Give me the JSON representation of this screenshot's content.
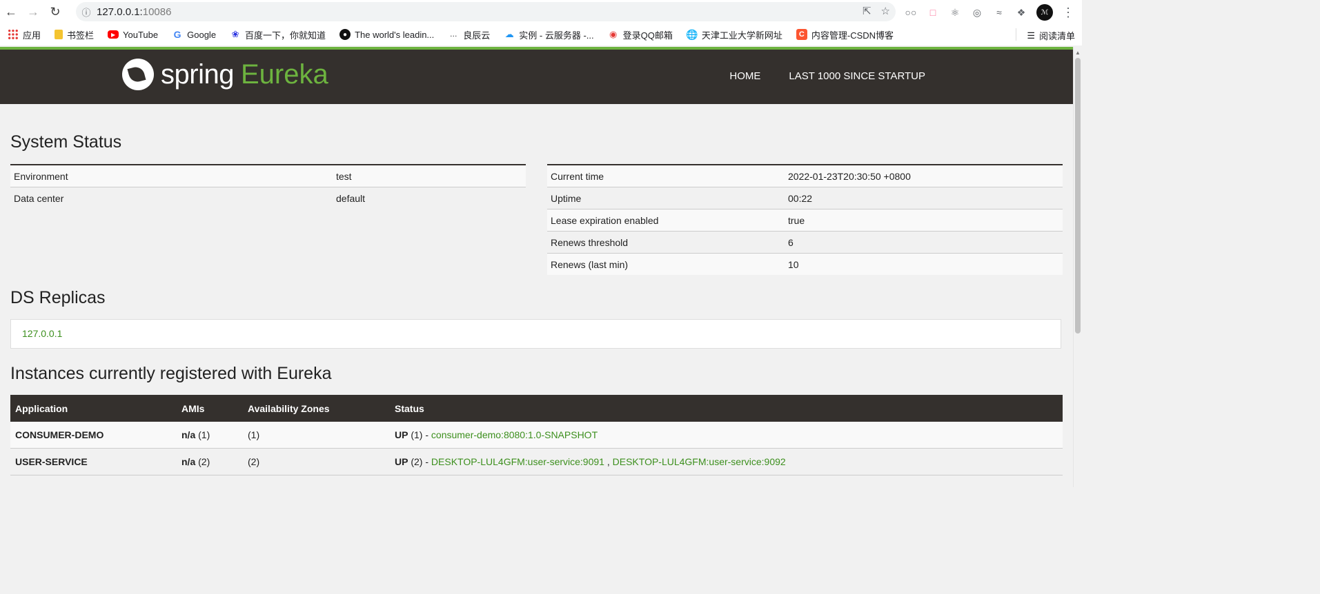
{
  "browser": {
    "url_host": "127.0.0.1:",
    "url_port": "10086",
    "bookmarks": [
      {
        "label": "应用",
        "icon": "apps-icon"
      },
      {
        "label": "书签栏",
        "icon": "folder-icon"
      },
      {
        "label": "YouTube",
        "icon": "youtube-icon"
      },
      {
        "label": "Google",
        "icon": "google-icon"
      },
      {
        "label": "百度一下，你就知道",
        "icon": "baidu-icon"
      },
      {
        "label": "The world's leadin...",
        "icon": "github-icon"
      },
      {
        "label": "良辰云",
        "icon": "cloud-dots-icon"
      },
      {
        "label": "实例 - 云服务器 -...",
        "icon": "cloud-icon"
      },
      {
        "label": "登录QQ邮箱",
        "icon": "qqmail-icon"
      },
      {
        "label": "天津工业大学新网址",
        "icon": "globe-icon"
      },
      {
        "label": "内容管理-CSDN博客",
        "icon": "csdn-icon"
      }
    ],
    "reading_list": "阅读清单"
  },
  "header": {
    "logo_spring": "spring",
    "logo_eureka": "Eureka",
    "nav_home": "HOME",
    "nav_last": "LAST 1000 SINCE STARTUP"
  },
  "system_status": {
    "title": "System Status",
    "left": [
      {
        "key": "Environment",
        "value": "test"
      },
      {
        "key": "Data center",
        "value": "default"
      }
    ],
    "right": [
      {
        "key": "Current time",
        "value": "2022-01-23T20:30:50 +0800"
      },
      {
        "key": "Uptime",
        "value": "00:22"
      },
      {
        "key": "Lease expiration enabled",
        "value": "true"
      },
      {
        "key": "Renews threshold",
        "value": "6"
      },
      {
        "key": "Renews (last min)",
        "value": "10"
      }
    ]
  },
  "ds_replicas": {
    "title": "DS Replicas",
    "link": "127.0.0.1"
  },
  "instances": {
    "title": "Instances currently registered with Eureka",
    "headers": {
      "application": "Application",
      "amis": "AMIs",
      "zones": "Availability Zones",
      "status": "Status"
    },
    "rows": [
      {
        "application": "CONSUMER-DEMO",
        "amis_prefix": "n/a",
        "amis_count": " (1)",
        "zones": "(1)",
        "status_prefix": "UP",
        "status_count": " (1) - ",
        "links": [
          "consumer-demo:8080:1.0-SNAPSHOT"
        ]
      },
      {
        "application": "USER-SERVICE",
        "amis_prefix": "n/a",
        "amis_count": " (2)",
        "zones": "(2)",
        "status_prefix": "UP",
        "status_count": " (2) - ",
        "links": [
          "DESKTOP-LUL4GFM:user-service:9091",
          "DESKTOP-LUL4GFM:user-service:9092"
        ],
        "link_sep": " , "
      }
    ]
  }
}
